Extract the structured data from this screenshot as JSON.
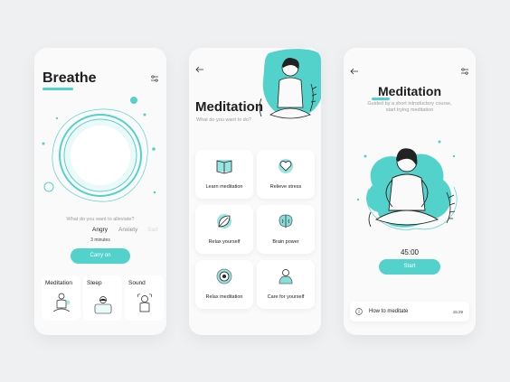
{
  "breathe": {
    "title": "Breathe",
    "question": "What do you want to alleviate?",
    "moods": [
      "Angry",
      "Anxiety",
      "Sad"
    ],
    "duration": "3 minutes",
    "cta": "Carry on",
    "categories": [
      "Meditation",
      "Sleep",
      "Sound"
    ]
  },
  "meditation_menu": {
    "title": "Meditation",
    "subtitle": "What do you want to do?",
    "items": [
      {
        "label": "Learn meditation",
        "icon": "book-icon"
      },
      {
        "label": "Relieve stress",
        "icon": "heart-icon"
      },
      {
        "label": "Relax yourself",
        "icon": "leaf-icon"
      },
      {
        "label": "Brain power",
        "icon": "brain-icon"
      },
      {
        "label": "Relax meditation",
        "icon": "target-icon"
      },
      {
        "label": "Care for yourself",
        "icon": "person-icon"
      }
    ]
  },
  "session": {
    "title": "Meditation",
    "description_line1": "Guided by a short introductory course,",
    "description_line2": "start trying meditation",
    "timer": "45:00",
    "cta": "Start",
    "track_title": "How to meditate",
    "track_time": "15:29"
  },
  "colors": {
    "accent": "#53d2cc",
    "text": "#222222",
    "muted": "#9a9a9a"
  }
}
